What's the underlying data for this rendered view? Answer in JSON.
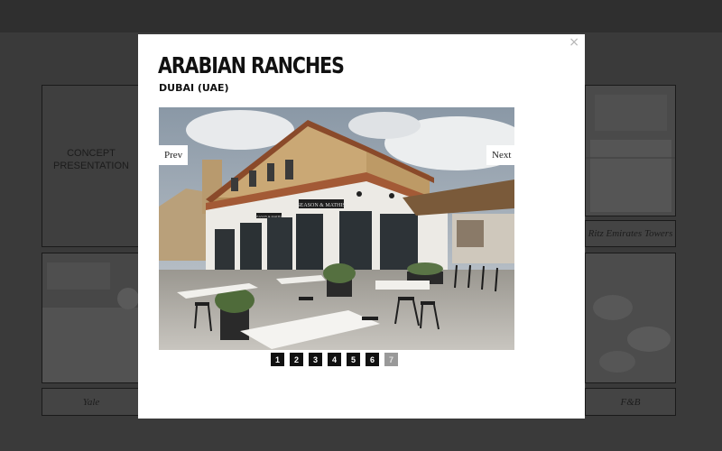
{
  "background": {
    "tiles": {
      "concept": "CONCEPT PRESENTATION",
      "yale": "Yale",
      "emirates_towers": "Ritz Emirates Towers",
      "fnb": "F&B"
    }
  },
  "modal": {
    "title": "ARABIAN RANCHES",
    "subtitle": "DUBAI (UAE)",
    "close": "×",
    "prev_label": "Prev",
    "next_label": "Next",
    "photo": {
      "sign_text": "SEASON & MATHIS",
      "sign_small": "SEASON & MATHIS"
    },
    "pages": [
      "1",
      "2",
      "3",
      "4",
      "5",
      "6",
      "7"
    ],
    "active_page": "7"
  },
  "colors": {
    "overlay": "#3a3a3a",
    "modal_bg": "#ffffff",
    "page_active": "#999999",
    "page_default": "#111111"
  }
}
